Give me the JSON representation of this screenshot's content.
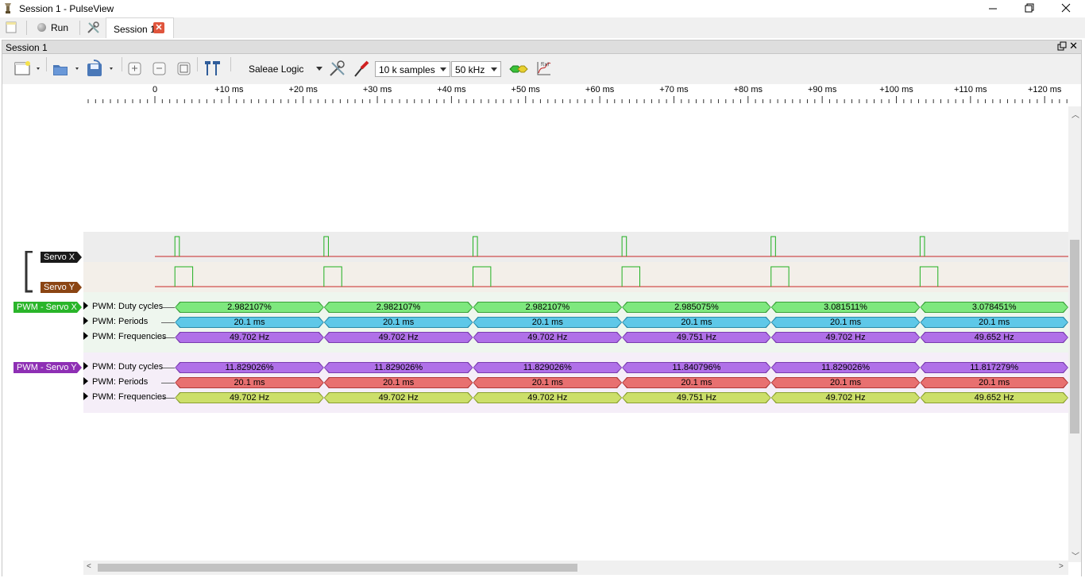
{
  "window": {
    "title": "Session 1 - PulseView",
    "minimize": "─",
    "restore": "❐",
    "close": "✕"
  },
  "tabs": {
    "run_label": "Run",
    "session_tab": "Session 1",
    "session_close": "✕"
  },
  "dock": {
    "title": "Session 1",
    "close": "✕"
  },
  "toolbar": {
    "device": "Saleae Logic",
    "samples": "10 k samples",
    "samplerate": "50 kHz",
    "icons": [
      "new-view-icon",
      "open-file-icon",
      "save-file-icon",
      "zoom-in-icon",
      "zoom-out-icon",
      "zoom-fit-icon",
      "cursors-icon",
      "device-settings-icon",
      "probe-icon",
      "add-decoder-icon",
      "math-channel-icon"
    ]
  },
  "ruler": {
    "ticks": [
      "0",
      "+10 ms",
      "+20 ms",
      "+30 ms",
      "+40 ms",
      "+50 ms",
      "+60 ms",
      "+70 ms",
      "+80 ms",
      "+90 ms",
      "+100 ms",
      "+110 ms",
      "+120 ms"
    ]
  },
  "channels": [
    {
      "name": "Servo X",
      "color": "#1a1a1a",
      "pulse_ms": 0.6,
      "period_ms": 20.1
    },
    {
      "name": "Servo Y",
      "color": "#8b4513",
      "pulse_ms": 2.4,
      "period_ms": 20.1
    }
  ],
  "decoders": [
    {
      "name": "PWM - Servo X",
      "tag_color": "#2ab52a",
      "rows": [
        {
          "label": "PWM: Duty cycles",
          "color": "#7ee87e",
          "border": "#3aa03a",
          "values": [
            "2.982107%",
            "2.982107%",
            "2.982107%",
            "2.985075%",
            "3.081511%",
            "3.078451%"
          ]
        },
        {
          "label": "PWM: Periods",
          "color": "#5ec8e8",
          "border": "#2a8aa8",
          "values": [
            "20.1 ms",
            "20.1 ms",
            "20.1 ms",
            "20.1 ms",
            "20.1 ms",
            "20.1 ms"
          ]
        },
        {
          "label": "PWM: Frequencies",
          "color": "#b070e8",
          "border": "#7a3cb0",
          "values": [
            "49.702 Hz",
            "49.702 Hz",
            "49.702 Hz",
            "49.751 Hz",
            "49.702 Hz",
            "49.652 Hz"
          ]
        }
      ]
    },
    {
      "name": "PWM - Servo Y",
      "tag_color": "#8e2fb4",
      "rows": [
        {
          "label": "PWM: Duty cycles",
          "color": "#b070e8",
          "border": "#7a3cb0",
          "values": [
            "11.829026%",
            "11.829026%",
            "11.829026%",
            "11.840796%",
            "11.829026%",
            "11.817279%"
          ]
        },
        {
          "label": "PWM: Periods",
          "color": "#e87070",
          "border": "#b03a3a",
          "values": [
            "20.1 ms",
            "20.1 ms",
            "20.1 ms",
            "20.1 ms",
            "20.1 ms",
            "20.1 ms"
          ]
        },
        {
          "label": "PWM: Frequencies",
          "color": "#ccdf6a",
          "border": "#8aa030",
          "values": [
            "49.702 Hz",
            "49.702 Hz",
            "49.702 Hz",
            "49.751 Hz",
            "49.702 Hz",
            "49.652 Hz"
          ]
        }
      ]
    }
  ]
}
